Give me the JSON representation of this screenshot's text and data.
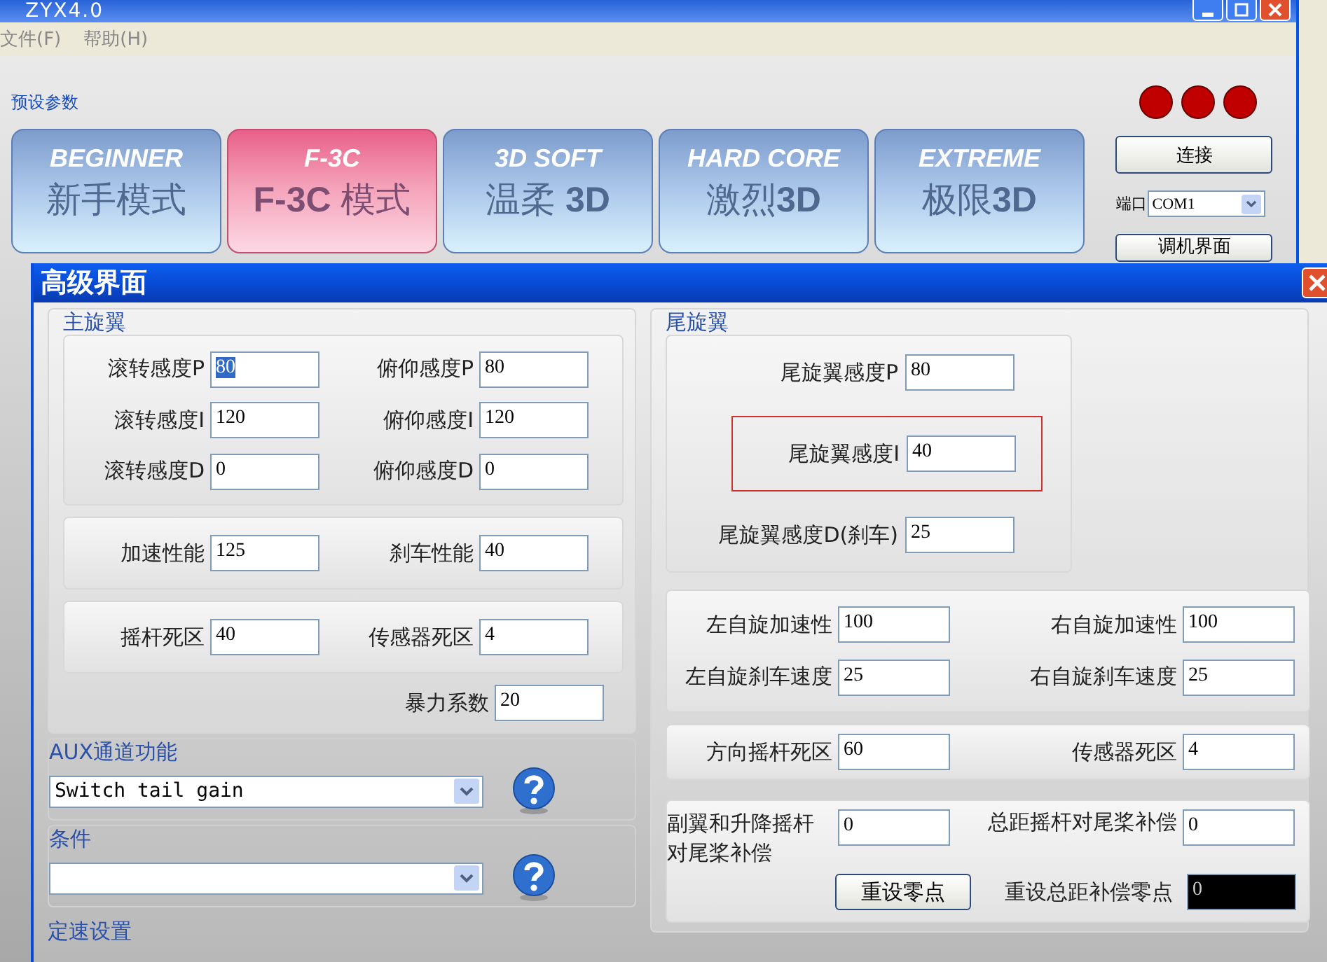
{
  "main_window": {
    "title": "ZYX4.0",
    "menu": [
      "文件(F)",
      "帮助(H)"
    ],
    "preset_group": {
      "label": "预设参数",
      "presets": [
        {
          "en": "BEGINNER",
          "zh": "新手模式",
          "selected": false
        },
        {
          "en": "F-3C",
          "zh": "**F-3C** 模式",
          "selected": true
        },
        {
          "en": "3D SOFT",
          "zh": "温柔 **3D**",
          "selected": false
        },
        {
          "en": "HARD CORE",
          "zh": "激烈**3D**",
          "selected": false
        },
        {
          "en": "EXTREME",
          "zh": "极限**3D**",
          "selected": false
        }
      ]
    },
    "connect_button": "连接",
    "port": {
      "label": "端口",
      "value": "COM1"
    },
    "tune_button": "调机界面"
  },
  "dialog": {
    "title": "高级界面",
    "main_rotor": {
      "label": "主旋翼",
      "gains": [
        [
          {
            "label": "滚转感度P",
            "value": "80",
            "text_selected": true
          },
          {
            "label": "俯仰感度P",
            "value": "80",
            "text_selected": false
          }
        ],
        [
          {
            "label": "滚转感度I",
            "value": "120",
            "text_selected": false
          },
          {
            "label": "俯仰感度I",
            "value": "120",
            "text_selected": false
          }
        ],
        [
          {
            "label": "滚转感度D",
            "value": "0",
            "text_selected": false
          },
          {
            "label": "俯仰感度D",
            "value": "0",
            "text_selected": false
          }
        ]
      ],
      "performance": [
        {
          "label": "加速性能",
          "value": "125"
        },
        {
          "label": "刹车性能",
          "value": "40"
        }
      ],
      "deadband": [
        {
          "label": "摇杆死区",
          "value": "40"
        },
        {
          "label": "传感器死区",
          "value": "4"
        }
      ],
      "force": {
        "label": "暴力系数",
        "value": "20"
      }
    },
    "aux": {
      "label": "AUX通道功能",
      "value": "Switch tail gain"
    },
    "condition": {
      "label": "条件"
    },
    "governor": {
      "label": "定速设置"
    },
    "tail_rotor": {
      "label": "尾旋翼",
      "gains": [
        {
          "label": "尾旋翼感度P",
          "value": "80",
          "outlined": false
        },
        {
          "label": "尾旋翼感度I",
          "value": "40",
          "outlined": true
        },
        {
          "label": "尾旋翼感度D(刹车)",
          "value": "25",
          "outlined": false
        }
      ],
      "spin": [
        [
          {
            "label": "左自旋加速性",
            "value": "100"
          },
          {
            "label": "右自旋加速性",
            "value": "100"
          }
        ],
        [
          {
            "label": "左自旋刹车速度",
            "value": "25"
          },
          {
            "label": "右自旋刹车速度",
            "value": "25"
          }
        ]
      ],
      "deadband": [
        {
          "label": "方向摇杆死区",
          "value": "60"
        },
        {
          "label": "传感器死区",
          "value": "4"
        }
      ],
      "compensation": [
        {
          "label": "副翼和升降摇杆对尾桨补偿",
          "value": "0"
        },
        {
          "label": "总距摇杆对尾桨补偿",
          "value": "0"
        }
      ],
      "reset_button": "重设零点",
      "reset_pitch": {
        "label": "重设总距补偿零点",
        "value": "0"
      }
    }
  }
}
